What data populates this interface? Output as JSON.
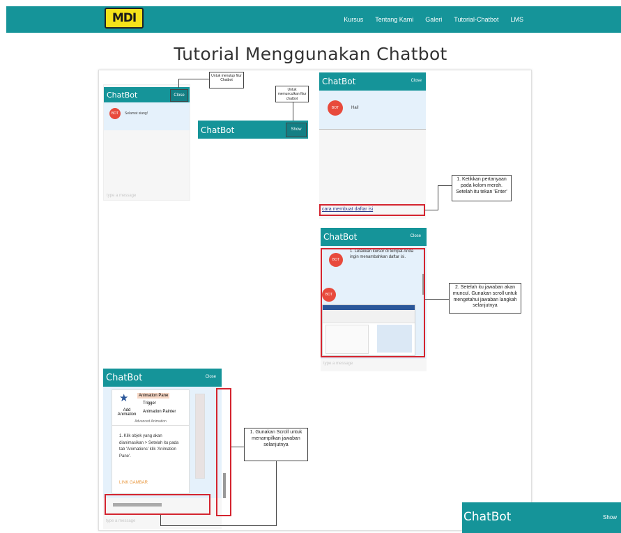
{
  "nav": {
    "logo_text": "MDI",
    "items": [
      "Kursus",
      "Tentang Kami",
      "Galeri",
      "Tutorial-Chatbot",
      "LMS"
    ]
  },
  "page": {
    "title": "Tutorial Menggunakan Chatbot"
  },
  "step1": {
    "chatbot_title": "ChatBot",
    "close_label": "Close",
    "bot_label": "BOT",
    "bot_message": "Selamat siang!",
    "placeholder": "type a message",
    "note_close": "Untuk menutup fitur Chatbot",
    "note_show": "Untuk memunculkan fitur chatbot",
    "show_title": "ChatBot",
    "show_label": "Show"
  },
  "step2": {
    "chatbot_title": "ChatBot",
    "close_label": "Close",
    "bot_label": "BOT",
    "bot_message": "Hai!",
    "input_value": "cara membuat daftar isi",
    "note": "1. Ketikkan pertanyaan pada kolom merah. Setelah itu tekan 'Enter'"
  },
  "step3": {
    "chatbot_title": "ChatBot",
    "close_label": "Close",
    "bot_label": "BOT",
    "bot_message": "1. Letakkan kursor di tempat Anda ingin menambahkan daftar isi.",
    "placeholder": "type a message",
    "note": "2. Setelah itu jawaban akan muncul. Gunakan scroll untuk mengetahui jawaban langkah selanjutnya"
  },
  "step4": {
    "chatbot_title": "ChatBot",
    "close_label": "Close",
    "menu_items": [
      "Animation Pane",
      "Trigger",
      "Animation Painter"
    ],
    "add_animation": "Add Animation",
    "group_label": "Advanced Animation",
    "message": "1. Klik objek yang akan dianimasikan > Setelah itu pada tab 'Animations' klik 'Animation Pane'.",
    "link_label": "LINK GAMBAR",
    "placeholder": "type a message",
    "note": "1. Gunakan Scroll untuk menampilkan jawaban selanjutnya"
  },
  "floating": {
    "chatbot_title": "ChatBot",
    "show_label": "Show"
  },
  "colors": {
    "teal": "#159499",
    "bot_red": "#e84a3c",
    "highlight_red": "#d4242f",
    "logo_yellow": "#f5e21a"
  }
}
